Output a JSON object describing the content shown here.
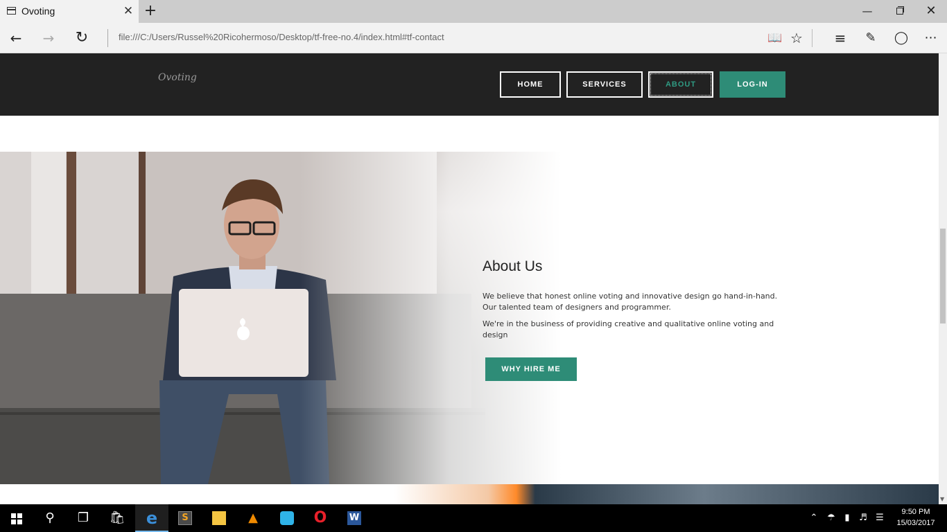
{
  "browser": {
    "tab_title": "Ovoting",
    "tab_close": "✕",
    "new_tab": "+",
    "address": "file:///C:/Users/Russel%20Ricohermoso/Desktop/tf-free-no.4/index.html#tf-contact",
    "window_controls": {
      "minimize": "—",
      "close": "✕"
    },
    "icons": {
      "back": "back-arrow-icon",
      "forward": "forward-arrow-icon",
      "refresh": "refresh-icon",
      "reading_view": "reading-view-icon",
      "favorite": "star-icon",
      "hub": "hub-icon",
      "web_note": "web-note-icon",
      "share": "share-icon",
      "more": "more-icon"
    }
  },
  "site": {
    "logo": "Ovoting",
    "nav": {
      "home": "HOME",
      "services": "SERVICES",
      "about": "ABOUT",
      "login": "LOG-IN"
    },
    "about": {
      "title": "About Us",
      "paragraph1": "We believe that honest online voting and innovative design go hand-in-hand. Our talented team of designers and programmer.",
      "paragraph2": "We're in the business of providing creative and qualitative online voting and design",
      "button": "WHY HIRE ME"
    }
  },
  "taskbar": {
    "time": "9:50 PM",
    "date": "15/03/2017",
    "apps": [
      "start",
      "search",
      "task-view",
      "store",
      "edge",
      "sublime-text",
      "file-explorer",
      "vlc",
      "app-circle",
      "opera",
      "word"
    ]
  },
  "colors": {
    "accent": "#2e8c77",
    "header_bg": "#222222",
    "about_active": "#2f9a82",
    "edge_chrome": "#f2f2f2",
    "taskbar": "#000000"
  }
}
